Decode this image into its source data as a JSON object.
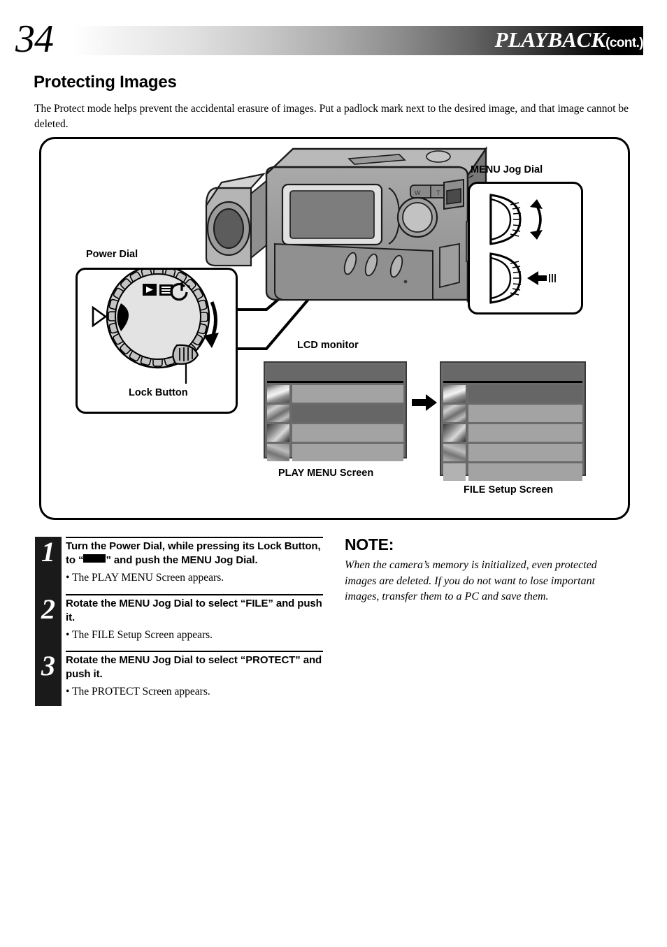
{
  "header": {
    "page_number": "34",
    "title": "PLAYBACK",
    "title_suffix": "(cont.)"
  },
  "section": {
    "title": "Protecting Images",
    "intro": "The Protect mode helps prevent the accidental erasure of images. Put a padlock mark next to the desired image, and that image cannot be deleted."
  },
  "figure": {
    "labels": {
      "menu_jog_dial": "MENU Jog Dial",
      "power_dial": "Power Dial",
      "lock_button": "Lock Button",
      "lcd_monitor": "LCD monitor",
      "play_menu_screen": "PLAY MENU Screen",
      "file_setup_screen": "FILE Setup Screen"
    },
    "icons": {
      "jog_rotate": "jog-dial-rotate-icon",
      "jog_push": "jog-dial-push-icon",
      "dial_pointer": "dial-pointer-triangle-icon",
      "dial_rotate_arrow": "dial-rotate-arrow-icon",
      "dial_mode_auto": "dial-mode-auto-icon",
      "dial_mode_manual": "dial-mode-manual-icon",
      "dial_mode_power": "dial-mode-power-icon",
      "flow_arrow": "right-arrow-icon"
    },
    "lcd_play_menu": {
      "title_row": "",
      "rows": [
        "",
        "",
        "",
        ""
      ],
      "selected_index": 1
    },
    "lcd_file_setup": {
      "title_row": "",
      "rows": [
        "",
        "",
        "",
        "",
        ""
      ],
      "selected_index": 0
    }
  },
  "steps": [
    {
      "number": "1",
      "title_before": "Turn the Power Dial, while pressing its Lock Button, to “",
      "title_after": "” and push the MENU Jog Dial.",
      "bullet": "• The PLAY MENU Screen appears."
    },
    {
      "number": "2",
      "title": "Rotate the MENU Jog Dial to select “FILE” and push it.",
      "bullet": "• The FILE Setup Screen appears."
    },
    {
      "number": "3",
      "title": "Rotate the MENU Jog Dial to select “PROTECT” and push it.",
      "bullet": "• The PROTECT Screen appears."
    }
  ],
  "note": {
    "title": "NOTE:",
    "body": "When the camera’s memory is initialized, even protected images are deleted. If you do not want to lose important images, transfer them to a PC and save them."
  },
  "colors": {
    "ink": "#000000",
    "header_gradient_end": "#000000",
    "lcd_background": "#6b6b6b",
    "lcd_item": "#a3a3a3",
    "lcd_item_selected": "#666666"
  }
}
